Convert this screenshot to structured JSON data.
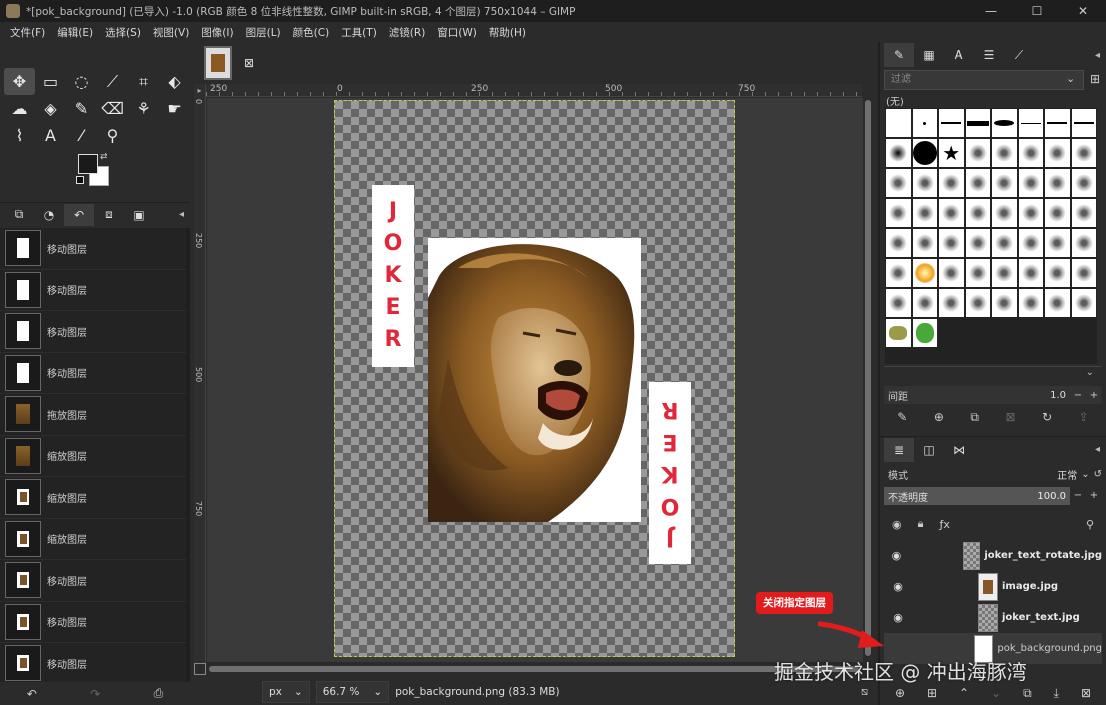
{
  "window": {
    "title": "*[pok_background] (已导入) -1.0 (RGB 颜色 8 位非线性整数, GIMP built-in sRGB, 4 个图层) 750x1044 – GIMP",
    "minimize": "—",
    "maximize": "☐",
    "close": "✕"
  },
  "menubar": [
    "文件(F)",
    "编辑(E)",
    "选择(S)",
    "视图(V)",
    "图像(I)",
    "图层(L)",
    "颜色(C)",
    "工具(T)",
    "滤镜(R)",
    "窗口(W)",
    "帮助(H)"
  ],
  "toolbox": {
    "tools": [
      {
        "name": "move-tool-icon",
        "glyph": "✥"
      },
      {
        "name": "rect-select-icon",
        "glyph": "▭"
      },
      {
        "name": "lasso-icon",
        "glyph": "◌"
      },
      {
        "name": "fuzzy-select-icon",
        "glyph": "⟋"
      },
      {
        "name": "crop-icon",
        "glyph": "⌗"
      },
      {
        "name": "transform-icon",
        "glyph": "⬖"
      },
      {
        "name": "warp-icon",
        "glyph": "☁"
      },
      {
        "name": "bucket-fill-icon",
        "glyph": "◈"
      },
      {
        "name": "paintbrush-icon",
        "glyph": "✎"
      },
      {
        "name": "eraser-icon",
        "glyph": "⌫"
      },
      {
        "name": "clone-icon",
        "glyph": "⚘"
      },
      {
        "name": "smudge-icon",
        "glyph": "☛"
      },
      {
        "name": "paths-icon",
        "glyph": "⌇"
      },
      {
        "name": "text-icon",
        "glyph": "A"
      },
      {
        "name": "color-picker-icon",
        "glyph": "⁄"
      },
      {
        "name": "zoom-icon",
        "glyph": "⚲"
      }
    ]
  },
  "left_tabs": [
    "⧉",
    "◔",
    "↶",
    "⧈",
    "▣"
  ],
  "history": [
    {
      "thumb": "white",
      "label": "移动图层"
    },
    {
      "thumb": "white",
      "label": "移动图层"
    },
    {
      "thumb": "white",
      "label": "移动图层"
    },
    {
      "thumb": "white",
      "label": "移动图层"
    },
    {
      "thumb": "lion",
      "label": "拖放图层"
    },
    {
      "thumb": "lion",
      "label": "缩放图层"
    },
    {
      "thumb": "small",
      "label": "缩放图层"
    },
    {
      "thumb": "small",
      "label": "缩放图层"
    },
    {
      "thumb": "small",
      "label": "移动图层"
    },
    {
      "thumb": "small",
      "label": "移动图层"
    },
    {
      "thumb": "small",
      "label": "移动图层"
    }
  ],
  "left_bottom": {
    "undo": "↶",
    "redo": "↷",
    "clear": "⎙"
  },
  "ruler_top_labels": [
    "250",
    "0",
    "250",
    "500",
    "750"
  ],
  "ruler_left_labels": [
    "0",
    "250",
    "500",
    "750"
  ],
  "canvas": {
    "joker_letters": [
      "J",
      "O",
      "K",
      "E",
      "R"
    ]
  },
  "status": {
    "unit": "px",
    "zoom": "66.7 %",
    "info": "pok_background.png (83.3 MB)"
  },
  "brushes": {
    "filter_placeholder": "过滤",
    "current": "(无)",
    "spacing_label": "间距",
    "spacing_value": "1.0"
  },
  "layers_panel": {
    "mode_label": "模式",
    "mode_value": "正常",
    "opacity_label": "不透明度",
    "opacity_value": "100.0",
    "layers": [
      {
        "name": "joker_text_rotate.jpg",
        "thumb": "checker",
        "visible": true,
        "selected": false
      },
      {
        "name": "image.jpg",
        "thumb": "lion",
        "visible": true,
        "selected": false
      },
      {
        "name": "joker_text.jpg",
        "thumb": "checker",
        "visible": true,
        "selected": false
      },
      {
        "name": "pok_background.png",
        "thumb": "white",
        "visible": false,
        "selected": true
      }
    ]
  },
  "annotation": {
    "badge": "关闭指定图层"
  },
  "watermark": "掘金技术社区 @ 冲出海豚湾"
}
